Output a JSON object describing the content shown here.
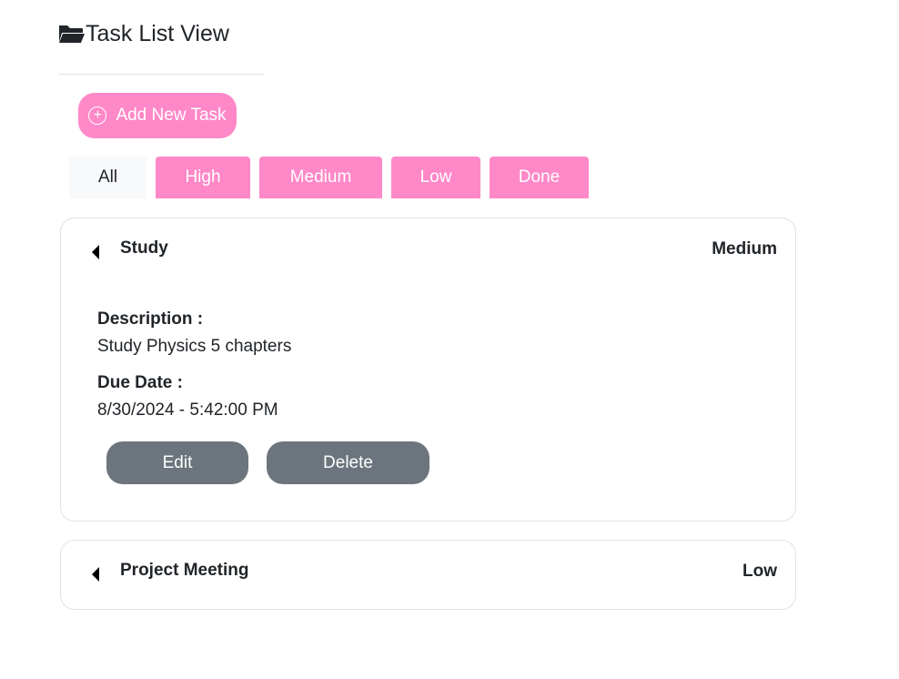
{
  "header": {
    "title": "Task List View",
    "icon": "folder-open-icon"
  },
  "add_button": {
    "label": "Add New Task",
    "icon": "plus-circle-icon"
  },
  "filters": [
    {
      "label": "All",
      "active": true
    },
    {
      "label": "High",
      "active": false
    },
    {
      "label": "Medium",
      "active": false
    },
    {
      "label": "Low",
      "active": false
    },
    {
      "label": "Done",
      "active": false
    }
  ],
  "tasks": [
    {
      "title": "Study",
      "priority": "Medium",
      "expanded": true,
      "description_label": "Description :",
      "description": "Study Physics 5 chapters",
      "due_label": "Due Date :",
      "due_date": "8/30/2024 - 5:42:00 PM",
      "edit_label": "Edit",
      "delete_label": "Delete"
    },
    {
      "title": "Project Meeting",
      "priority": "Low",
      "expanded": false
    }
  ],
  "colors": {
    "accent": "#ff88c8",
    "action_button": "#6c757d",
    "active_filter_bg": "#f8f9fa",
    "border": "#dee2e6"
  }
}
